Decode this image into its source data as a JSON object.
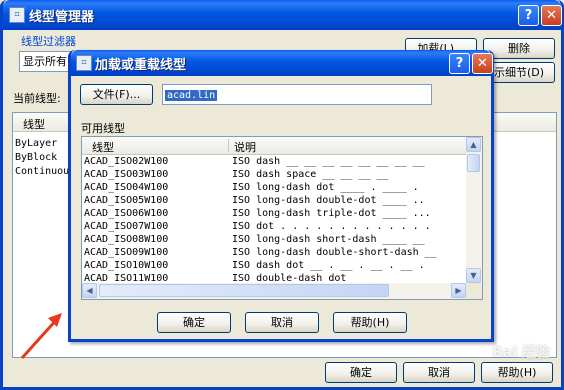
{
  "outer": {
    "title": "线型管理器",
    "filter_group_label": "线型过滤器",
    "filter_value": "显示所有",
    "load_button": "加载(L)...",
    "delete_button": "删除",
    "details_button": "示细节(D)",
    "current_label": "当前线型:",
    "list_header": "线型",
    "list_items": [
      "ByLayer",
      "ByBlock",
      "Continuou"
    ],
    "ok_button": "确定",
    "cancel_button": "取消",
    "help_button": "帮助(H)"
  },
  "dialog": {
    "title": "加载或重载线型",
    "file_button": "文件(F)...",
    "file_value": "acad.lin",
    "available_label": "可用线型",
    "col_linetype": "线型",
    "col_description": "说明",
    "rows": [
      {
        "name": "ACAD_ISO02W100",
        "desc": "ISO dash __ __ __ __ __ __ __ __"
      },
      {
        "name": "ACAD_ISO03W100",
        "desc": "ISO dash space __   __   __   __"
      },
      {
        "name": "ACAD_ISO04W100",
        "desc": "ISO long-dash dot ____ . ____ ."
      },
      {
        "name": "ACAD_ISO05W100",
        "desc": "ISO long-dash double-dot ____ .."
      },
      {
        "name": "ACAD_ISO06W100",
        "desc": "ISO long-dash triple-dot ____ ..."
      },
      {
        "name": "ACAD_ISO07W100",
        "desc": "ISO dot . . . . . . . . . . . . ."
      },
      {
        "name": "ACAD_ISO08W100",
        "desc": "ISO long-dash short-dash ____ __"
      },
      {
        "name": "ACAD_ISO09W100",
        "desc": "ISO long-dash double-short-dash __"
      },
      {
        "name": "ACAD_ISO10W100",
        "desc": "ISO dash dot __ . __ . __ . __ ."
      },
      {
        "name": "ACAD_ISO11W100",
        "desc": "ISO double-dash dot"
      }
    ],
    "ok_button": "确定",
    "cancel_button": "取消",
    "help_button": "帮助(H)"
  },
  "watermark": "Bai 经验",
  "colors": {
    "titlebar": "#0054e3",
    "selection": "#316ac5",
    "arrow": "#e8391c"
  }
}
